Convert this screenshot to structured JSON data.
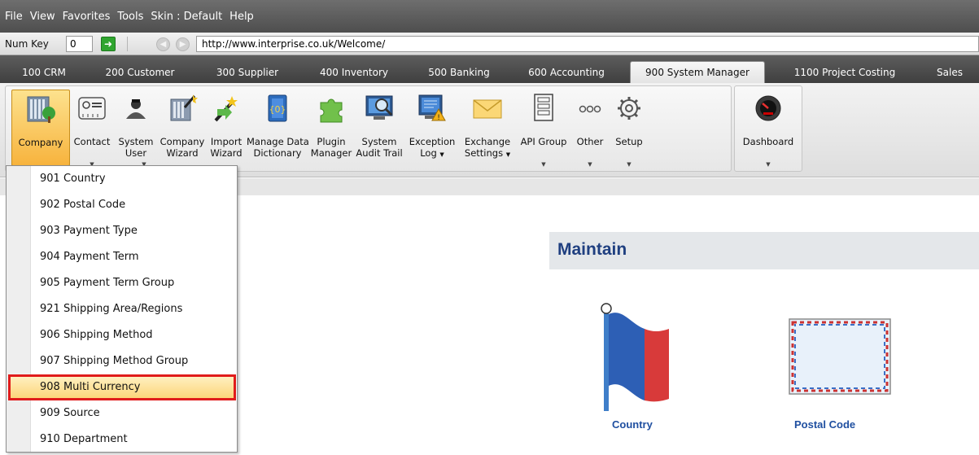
{
  "menubar": {
    "items": [
      "File",
      "View",
      "Favorites",
      "Tools",
      "Skin : Default",
      "Help"
    ]
  },
  "addressbar": {
    "numkey_label": "Num Key",
    "numkey_value": "0",
    "url": "http://www.interprise.co.uk/Welcome/"
  },
  "tabs": [
    {
      "label": "100 CRM"
    },
    {
      "label": "200 Customer"
    },
    {
      "label": "300 Supplier"
    },
    {
      "label": "400 Inventory"
    },
    {
      "label": "500 Banking"
    },
    {
      "label": "600 Accounting"
    },
    {
      "label": "900 System Manager",
      "active": true
    },
    {
      "label": "1100 Project Costing"
    },
    {
      "label": "Sales"
    }
  ],
  "ribbon": {
    "buttons": [
      {
        "line1": "Company",
        "line2": "",
        "dropdown": false,
        "icon": "company-icon",
        "active": true
      },
      {
        "line1": "Contact",
        "line2": "",
        "dropdown": true,
        "icon": "contact-card-icon"
      },
      {
        "line1": "System",
        "line2": "User",
        "dropdown": true,
        "icon": "system-user-icon"
      },
      {
        "line1": "Company",
        "line2": "Wizard",
        "dropdown": true,
        "icon": "company-wizard-icon"
      },
      {
        "line1": "Import",
        "line2": "Wizard",
        "dropdown": false,
        "icon": "import-wizard-icon"
      },
      {
        "line1": "Manage Data",
        "line2": "Dictionary",
        "dropdown": false,
        "icon": "data-dictionary-icon"
      },
      {
        "line1": "Plugin",
        "line2": "Manager",
        "dropdown": false,
        "icon": "puzzle-icon"
      },
      {
        "line1": "System",
        "line2": "Audit Trail",
        "dropdown": false,
        "icon": "audit-trail-icon"
      },
      {
        "line1": "Exception",
        "line2": "Log",
        "dropdown": true,
        "icon": "exception-log-icon"
      },
      {
        "line1": "Exchange",
        "line2": "Settings",
        "dropdown": true,
        "icon": "envelope-icon"
      },
      {
        "line1": "API Group",
        "line2": "",
        "dropdown": true,
        "icon": "api-group-icon"
      },
      {
        "line1": "Other",
        "line2": "",
        "dropdown": true,
        "icon": "ellipsis-icon"
      },
      {
        "line1": "Setup",
        "line2": "",
        "dropdown": true,
        "icon": "gear-icon"
      },
      {
        "line1": "Dashboard",
        "line2": "",
        "dropdown": true,
        "icon": "gauge-icon"
      }
    ],
    "dropdown_glyph": "▼"
  },
  "dropdown": {
    "items": [
      "901 Country",
      "902 Postal Code",
      "903 Payment Type",
      "904 Payment Term",
      "905 Payment Term Group",
      "921 Shipping Area/Regions",
      "906 Shipping Method",
      "907 Shipping Method Group",
      "908 Multi Currency",
      "909 Source",
      "910 Department"
    ],
    "highlighted_index": 8
  },
  "main": {
    "section_title": "Maintain",
    "tiles": [
      {
        "label": "Country",
        "icon": "flag-icon"
      },
      {
        "label": "Postal Code",
        "icon": "postal-envelope-icon"
      }
    ]
  },
  "colors": {
    "highlight_border": "#e01b1b",
    "active_tab_bg": "#eeeeee",
    "section_title": "#1f3f80",
    "tile_label": "#1f4fa0"
  }
}
